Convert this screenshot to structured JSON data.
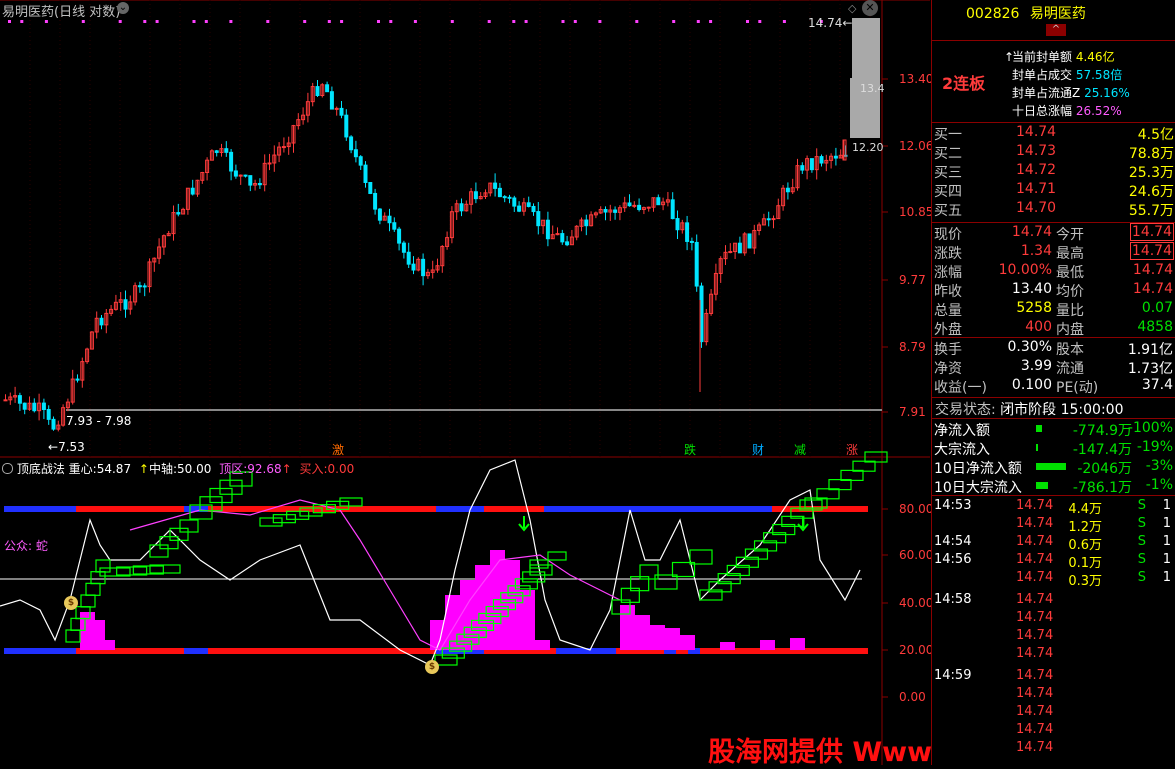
{
  "header": {
    "title": "易明医药",
    "period": "(日线 对数)"
  },
  "price_axis": {
    "ticks": [
      "13.40",
      "12.06",
      "10.85",
      "9.77",
      "8.79",
      "7.91"
    ],
    "current_box": "14.74",
    "box2": "13.4",
    "box3": "12.20"
  },
  "annotations": {
    "range_label": "7.93 - 7.98",
    "low_label": "7.53",
    "high_label": "14.74"
  },
  "event_markers": [
    "激",
    "跌",
    "财",
    "减",
    "涨"
  ],
  "indicator": {
    "name": "顶底战法",
    "zhongxin_label": "重心:",
    "zhongxin_value": "54.87",
    "zhongzhou_label": "中轴:",
    "zhongzhou_value": "50.00",
    "dingqu_label": "顶区:",
    "dingqu_value": "92.68",
    "mairu_label": "买入:",
    "mairu_value": "0.00",
    "gongzhong": "公众: 蛇",
    "ticks": [
      "80.00",
      "60.00",
      "40.00",
      "20.00",
      "0.00"
    ]
  },
  "colors": {
    "up": "#ff3b3b",
    "down": "#00e5ff",
    "magenta": "#ff00ff",
    "green": "#00ff00"
  },
  "quote": {
    "code": "002826",
    "name": "易明医药",
    "streak": "2连板",
    "seal_info": [
      {
        "label": "当前封单额",
        "value": "4.46亿"
      },
      {
        "label": "封单占成交",
        "value": "57.58倍"
      },
      {
        "label": "封单占流通Z",
        "value": "25.16%"
      },
      {
        "label": "十日总涨幅",
        "value": "26.52%"
      }
    ],
    "bids": [
      {
        "label": "买一",
        "price": "14.74",
        "vol": "4.5亿"
      },
      {
        "label": "买二",
        "price": "14.73",
        "vol": "78.8万"
      },
      {
        "label": "买三",
        "price": "14.72",
        "vol": "25.3万"
      },
      {
        "label": "买四",
        "price": "14.71",
        "vol": "24.6万"
      },
      {
        "label": "买五",
        "price": "14.70",
        "vol": "55.7万"
      }
    ],
    "stats": [
      {
        "l1": "现价",
        "v1": "14.74",
        "l2": "今开",
        "v2": "14.74"
      },
      {
        "l1": "涨跌",
        "v1": "1.34",
        "l2": "最高",
        "v2": "14.74"
      },
      {
        "l1": "涨幅",
        "v1": "10.00%",
        "l2": "最低",
        "v2": "14.74"
      },
      {
        "l1": "昨收",
        "v1": "13.40",
        "l2": "均价",
        "v2": "14.74"
      },
      {
        "l1": "总量",
        "v1": "5258",
        "l2": "量比",
        "v2": "0.07"
      },
      {
        "l1": "外盘",
        "v1": "400",
        "l2": "内盘",
        "v2": "4858"
      }
    ],
    "stats2": [
      {
        "l1": "换手",
        "v1": "0.30%",
        "l2": "股本",
        "v2": "1.91亿"
      },
      {
        "l1": "净资",
        "v1": "3.99",
        "l2": "流通",
        "v2": "1.73亿"
      },
      {
        "l1": "收益(一)",
        "v1": "0.100",
        "l2": "PE(动)",
        "v2": "37.4"
      }
    ],
    "trade_status_label": "交易状态:",
    "trade_status_value": "闭市阶段 15:00:00",
    "flows": [
      {
        "label": "净流入额",
        "value": "-774.9万",
        "pct": "-100%",
        "bar": 0.2
      },
      {
        "label": "大宗流入",
        "value": "-147.4万",
        "pct": "-19%",
        "bar": 0.03
      },
      {
        "label": "10日净流入额",
        "value": "-2046万",
        "pct": "-3%",
        "bar": 1
      },
      {
        "label": "10日大宗流入",
        "value": "-786.1万",
        "pct": "-1%",
        "bar": 0.4
      }
    ],
    "ticks": [
      {
        "time": "14:53",
        "price": "14.74",
        "vol": "4.4万",
        "side": "S",
        "n": "1"
      },
      {
        "time": "",
        "price": "14.74",
        "vol": "1.2万",
        "side": "S",
        "n": "1"
      },
      {
        "time": "14:54",
        "price": "14.74",
        "vol": "0.6万",
        "side": "S",
        "n": "1"
      },
      {
        "time": "14:56",
        "price": "14.74",
        "vol": "0.1万",
        "side": "S",
        "n": "1"
      },
      {
        "time": "",
        "price": "14.74",
        "vol": "0.3万",
        "side": "S",
        "n": "1"
      },
      {
        "time": "14:58",
        "price": "14.74",
        "vol": "",
        "side": "",
        "n": ""
      },
      {
        "time": "",
        "price": "14.74",
        "vol": "",
        "side": "",
        "n": ""
      },
      {
        "time": "",
        "price": "14.74",
        "vol": "",
        "side": "",
        "n": ""
      },
      {
        "time": "",
        "price": "14.74",
        "vol": "",
        "side": "",
        "n": ""
      },
      {
        "time": "14:59",
        "price": "14.74",
        "vol": "",
        "side": "",
        "n": ""
      },
      {
        "time": "",
        "price": "14.74",
        "vol": "",
        "side": "",
        "n": ""
      },
      {
        "time": "",
        "price": "14.74",
        "vol": "",
        "side": "",
        "n": ""
      },
      {
        "time": "",
        "price": "14.74",
        "vol": "",
        "side": "",
        "n": ""
      },
      {
        "time": "",
        "price": "14.74",
        "vol": "",
        "side": "",
        "n": ""
      }
    ]
  },
  "watermark": "股海网提供 Www.Guhai.Com.CN"
}
